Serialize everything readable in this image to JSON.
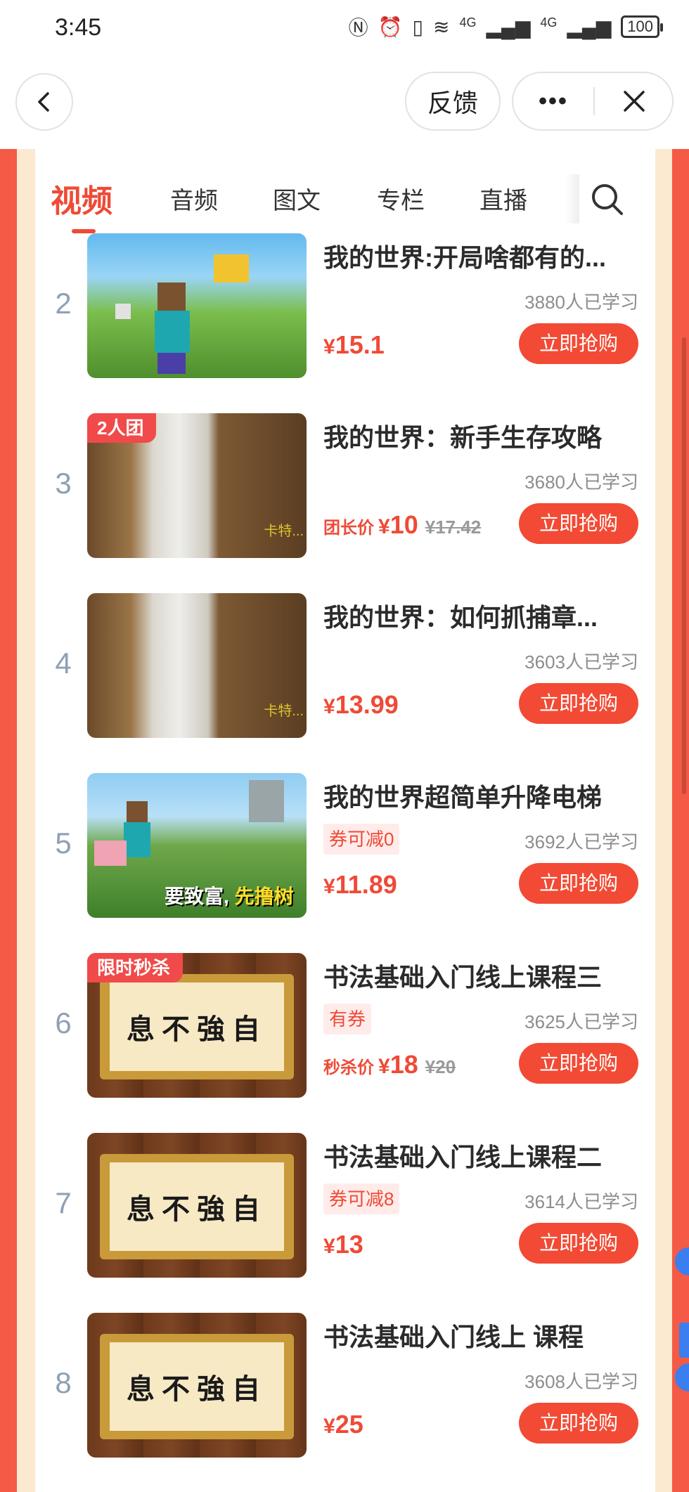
{
  "status_bar": {
    "time": "3:45",
    "network_1": "4G",
    "network_2": "4G",
    "battery": "100"
  },
  "nav": {
    "feedback_label": "反馈",
    "more_label": "•••"
  },
  "tabs": [
    {
      "label": "视频",
      "active": true
    },
    {
      "label": "音频",
      "active": false
    },
    {
      "label": "图文",
      "active": false
    },
    {
      "label": "专栏",
      "active": false
    },
    {
      "label": "直播",
      "active": false
    }
  ],
  "courses": [
    {
      "rank": "2",
      "title": "我的世界:开局啥都有的...",
      "learners": "3880人已学习",
      "price_label": "",
      "currency": "¥",
      "price": "15.1",
      "old_price": "",
      "coupon": "",
      "tag": "",
      "button": "立即抢购",
      "thumb_caption": "",
      "thumb_watermark": ""
    },
    {
      "rank": "3",
      "title": "我的世界：新手生存攻略",
      "learners": "3680人已学习",
      "price_label": "团长价",
      "currency": "¥",
      "price": "10",
      "old_price": "¥17.42",
      "coupon": "",
      "tag": "2人团",
      "button": "立即抢购",
      "thumb_caption": "",
      "thumb_watermark": "卡特..."
    },
    {
      "rank": "4",
      "title": "我的世界：如何抓捕章...",
      "learners": "3603人已学习",
      "price_label": "",
      "currency": "¥",
      "price": "13.99",
      "old_price": "",
      "coupon": "",
      "tag": "",
      "button": "立即抢购",
      "thumb_caption": "",
      "thumb_watermark": "卡特..."
    },
    {
      "rank": "5",
      "title": "我的世界超简单升降电梯",
      "learners": "3692人已学习",
      "price_label": "",
      "currency": "¥",
      "price": "11.89",
      "old_price": "",
      "coupon": "券可减0",
      "tag": "",
      "button": "立即抢购",
      "thumb_caption_a": "要致富, ",
      "thumb_caption_b": "先撸树",
      "thumb_watermark": ""
    },
    {
      "rank": "6",
      "title": "书法基础入门线上课程三",
      "learners": "3625人已学习",
      "price_label": "秒杀价",
      "currency": "¥",
      "price": "18",
      "old_price": "¥20",
      "coupon": "有券",
      "tag": "限时秒杀",
      "button": "立即抢购",
      "scroll_text": "息不強自",
      "thumb_watermark": ""
    },
    {
      "rank": "7",
      "title": "书法基础入门线上课程二",
      "learners": "3614人已学习",
      "price_label": "",
      "currency": "¥",
      "price": "13",
      "old_price": "",
      "coupon": "券可减8",
      "tag": "",
      "button": "立即抢购",
      "scroll_text": "息不強自",
      "thumb_watermark": ""
    },
    {
      "rank": "8",
      "title": "书法基础入门线上 课程",
      "learners": "3608人已学习",
      "price_label": "",
      "currency": "¥",
      "price": "25",
      "old_price": "",
      "coupon": "",
      "tag": "",
      "button": "立即抢购",
      "scroll_text": "息不強自",
      "thumb_watermark": ""
    }
  ],
  "colors": {
    "accent": "#ef4a36",
    "frame": "#f45a45",
    "frame_inner": "#fbe9d0",
    "rank": "#8fa0b4"
  },
  "icons": {
    "back": "chevron-left-icon",
    "close": "close-icon",
    "search": "search-icon"
  }
}
